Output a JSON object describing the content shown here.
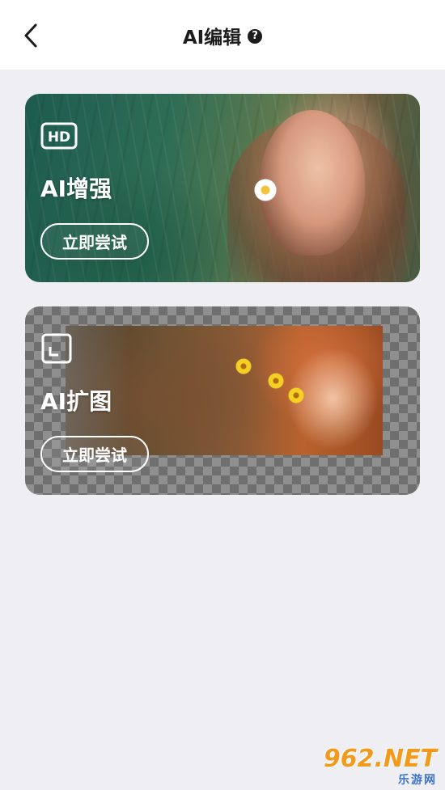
{
  "header": {
    "title": "AI编辑",
    "help_glyph": "?"
  },
  "cards": [
    {
      "icon": "hd-icon",
      "title": "AI增强",
      "button": "立即尝试"
    },
    {
      "icon": "expand-frame-icon",
      "title": "AI扩图",
      "button": "立即尝试"
    }
  ],
  "watermark": {
    "main": "962.NET",
    "sub": "乐游网"
  },
  "colors": {
    "background": "#efeff3",
    "header": "#ffffff",
    "text": "#1c1c1c",
    "watermark_orange": "#f29a1d",
    "watermark_blue": "#3c74c6"
  }
}
